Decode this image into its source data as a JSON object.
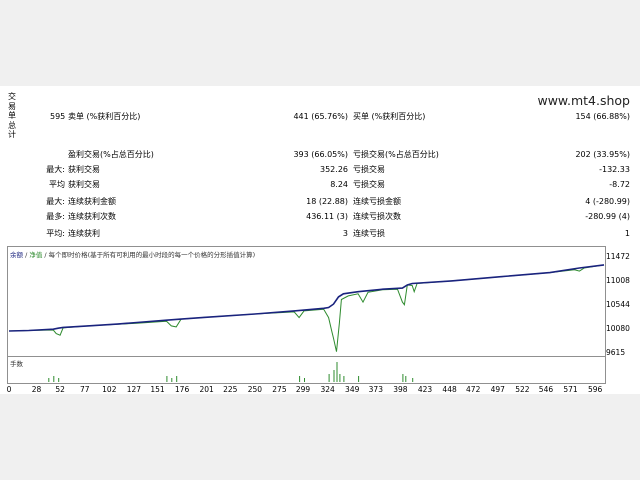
{
  "watermark": "www.mt4.shop",
  "side_label": [
    "交",
    "易",
    "单",
    "总",
    "计"
  ],
  "stats": {
    "total_trades": "595",
    "short_label": "卖单 (%获利百分比)",
    "short_value": "441 (65.76%)",
    "long_label": "买单 (%获利百分比)",
    "long_value": "154 (66.88%)",
    "profit_trades_label": "盈利交易(%占总百分比)",
    "profit_trades_value": "393 (66.05%)",
    "loss_trades_label": "亏损交易(%占总百分比)",
    "loss_trades_value": "202 (33.95%)",
    "largest_label": "最大:",
    "largest_profit_label": "获利交易",
    "largest_profit_value": "352.26",
    "largest_loss_label": "亏损交易",
    "largest_loss_value": "-132.33",
    "average_label": "平均",
    "avg_profit_label": "获利交易",
    "avg_profit_value": "8.24",
    "avg_loss_label": "亏损交易",
    "avg_loss_value": "-8.72",
    "max_label": "最大:",
    "max_consec_wins_label": "连续获利金额",
    "max_consec_wins_value": "18 (22.88)",
    "max_consec_losses_label": "连续亏损金额",
    "max_consec_losses_value": "4 (-280.99)",
    "most_label": "最多:",
    "max_consec_profit_label": "连续获利次数",
    "max_consec_profit_value": "436.11 (3)",
    "max_consec_loss_label": "连续亏损次数",
    "max_consec_loss_value": "-280.99 (4)",
    "avg2_label": "平均:",
    "avg_consec_wins_label": "连续获利",
    "avg_consec_wins_value": "3",
    "avg_consec_losses_label": "连续亏损",
    "avg_consec_losses_value": "1"
  },
  "legend": {
    "balance": "余额",
    "sep": " / ",
    "equity": "净值",
    "rest": " / 每个即时价格(基于所有可利用的最小时段的每一个价格的分形插值计算)"
  },
  "volume_title": "手数",
  "colors": {
    "balance": "#1a237e",
    "equity": "#2e8b2e",
    "volume": "#2e8b2e"
  },
  "chart_data": {
    "type": "line",
    "x_ticks": [
      "0",
      "28",
      "52",
      "77",
      "102",
      "127",
      "151",
      "176",
      "201",
      "225",
      "250",
      "275",
      "299",
      "324",
      "349",
      "373",
      "398",
      "423",
      "448",
      "472",
      "497",
      "522",
      "546",
      "571",
      "596"
    ],
    "y_ticks": [
      "11472",
      "11008",
      "10544",
      "10080",
      "9615"
    ],
    "ylim": [
      9615,
      11472
    ],
    "xlim": [
      0,
      605
    ],
    "series": [
      {
        "name": "余额",
        "points": [
          [
            0,
            10040
          ],
          [
            20,
            10050
          ],
          [
            45,
            10075
          ],
          [
            50,
            10095
          ],
          [
            55,
            10110
          ],
          [
            80,
            10140
          ],
          [
            110,
            10175
          ],
          [
            130,
            10205
          ],
          [
            160,
            10250
          ],
          [
            175,
            10270
          ],
          [
            200,
            10305
          ],
          [
            250,
            10370
          ],
          [
            290,
            10430
          ],
          [
            320,
            10480
          ],
          [
            325,
            10495
          ],
          [
            330,
            10560
          ],
          [
            335,
            10700
          ],
          [
            340,
            10760
          ],
          [
            355,
            10800
          ],
          [
            380,
            10850
          ],
          [
            400,
            10870
          ],
          [
            405,
            10930
          ],
          [
            410,
            10960
          ],
          [
            450,
            11010
          ],
          [
            500,
            11090
          ],
          [
            550,
            11170
          ],
          [
            580,
            11260
          ],
          [
            605,
            11320
          ]
        ]
      },
      {
        "name": "净值",
        "points": [
          [
            0,
            10040
          ],
          [
            20,
            10050
          ],
          [
            45,
            10060
          ],
          [
            48,
            9990
          ],
          [
            52,
            9960
          ],
          [
            55,
            10100
          ],
          [
            80,
            10140
          ],
          [
            110,
            10170
          ],
          [
            130,
            10190
          ],
          [
            160,
            10230
          ],
          [
            165,
            10140
          ],
          [
            170,
            10120
          ],
          [
            175,
            10270
          ],
          [
            200,
            10305
          ],
          [
            250,
            10370
          ],
          [
            290,
            10410
          ],
          [
            295,
            10300
          ],
          [
            300,
            10430
          ],
          [
            320,
            10460
          ],
          [
            325,
            10300
          ],
          [
            328,
            10050
          ],
          [
            330,
            9900
          ],
          [
            333,
            9640
          ],
          [
            336,
            10200
          ],
          [
            338,
            10650
          ],
          [
            345,
            10720
          ],
          [
            355,
            10760
          ],
          [
            360,
            10600
          ],
          [
            365,
            10790
          ],
          [
            380,
            10840
          ],
          [
            395,
            10850
          ],
          [
            400,
            10600
          ],
          [
            402,
            10550
          ],
          [
            405,
            10930
          ],
          [
            410,
            10920
          ],
          [
            412,
            10800
          ],
          [
            415,
            10960
          ],
          [
            450,
            11010
          ],
          [
            500,
            11090
          ],
          [
            550,
            11170
          ],
          [
            575,
            11225
          ],
          [
            580,
            11200
          ],
          [
            585,
            11260
          ],
          [
            605,
            11320
          ]
        ]
      }
    ],
    "volume": [
      [
        40,
        2
      ],
      [
        45,
        3
      ],
      [
        50,
        2
      ],
      [
        160,
        3
      ],
      [
        165,
        2
      ],
      [
        170,
        3
      ],
      [
        295,
        3
      ],
      [
        300,
        2
      ],
      [
        325,
        4
      ],
      [
        330,
        6
      ],
      [
        333,
        10
      ],
      [
        336,
        4
      ],
      [
        340,
        3
      ],
      [
        355,
        3
      ],
      [
        400,
        4
      ],
      [
        403,
        3
      ],
      [
        410,
        2
      ]
    ]
  }
}
